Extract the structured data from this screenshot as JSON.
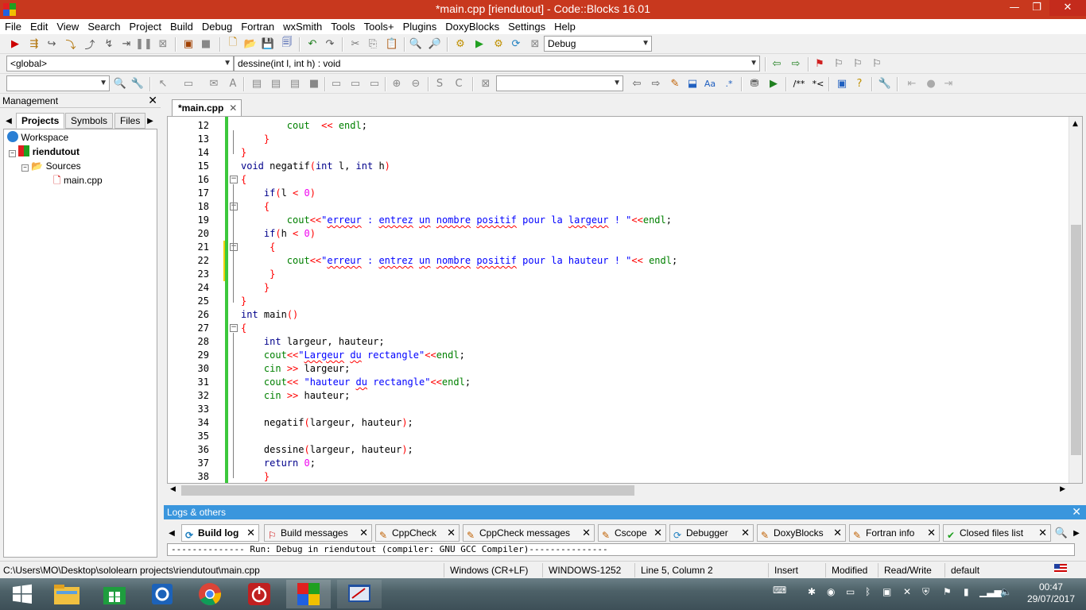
{
  "window": {
    "title": "*main.cpp [riendutout] - Code::Blocks 16.01",
    "minimize": "—",
    "restore": "❐",
    "close": "✕"
  },
  "menu": [
    "File",
    "Edit",
    "View",
    "Search",
    "Project",
    "Build",
    "Debug",
    "Fortran",
    "wxSmith",
    "Tools",
    "Tools+",
    "Plugins",
    "DoxyBlocks",
    "Settings",
    "Help"
  ],
  "toolbar": {
    "build_target": "Debug",
    "scope": "<global>",
    "function": "dessine(int l, int h) : void",
    "search_value": ""
  },
  "management": {
    "title": "Management",
    "tabs": [
      "Projects",
      "Symbols",
      "Files"
    ],
    "tree": {
      "workspace": "Workspace",
      "project": "riendutout",
      "folder": "Sources",
      "file": "main.cpp"
    }
  },
  "editor": {
    "tab_label": "*main.cpp",
    "lines": [
      {
        "n": "12",
        "indent": "        ",
        "tokens": [
          [
            "fn",
            "cout"
          ],
          [
            "",
            "  "
          ],
          [
            "op",
            "<<"
          ],
          [
            "",
            ""
          ],
          [
            "fn",
            " endl"
          ],
          [
            "",
            "; "
          ]
        ]
      },
      {
        "n": "13",
        "indent": "    ",
        "tokens": [
          [
            "brc",
            "}"
          ]
        ]
      },
      {
        "n": "14",
        "indent": "",
        "tokens": [
          [
            "brc",
            "}"
          ]
        ]
      },
      {
        "n": "15",
        "indent": "",
        "tokens": [
          [
            "kw",
            "void"
          ],
          [
            "",
            " negatif"
          ],
          [
            "op",
            "("
          ],
          [
            "kw",
            "int"
          ],
          [
            "",
            " l, "
          ],
          [
            "kw",
            "int"
          ],
          [
            "",
            " h"
          ],
          [
            "op",
            ")"
          ]
        ]
      },
      {
        "n": "16",
        "indent": "",
        "tokens": [
          [
            "brc",
            "{"
          ]
        ]
      },
      {
        "n": "17",
        "indent": "    ",
        "tokens": [
          [
            "kw",
            "if"
          ],
          [
            "op",
            "("
          ],
          [
            "",
            "l "
          ],
          [
            "op",
            "<"
          ],
          [
            "num",
            " 0"
          ],
          [
            "op",
            ")"
          ]
        ]
      },
      {
        "n": "18",
        "indent": "    ",
        "tokens": [
          [
            "brc",
            "{"
          ]
        ]
      },
      {
        "n": "19",
        "indent": "        ",
        "tokens": [
          [
            "fn",
            "cout"
          ],
          [
            "op",
            "<<"
          ],
          [
            "str",
            "\""
          ],
          [
            "sq",
            "erreur"
          ],
          [
            "str",
            " : "
          ],
          [
            "sq",
            "entrez"
          ],
          [
            "str",
            " "
          ],
          [
            "sq",
            "un"
          ],
          [
            "str",
            " "
          ],
          [
            "sq",
            "nombre"
          ],
          [
            "str",
            " "
          ],
          [
            "sq",
            "positif"
          ],
          [
            "str",
            " pour la "
          ],
          [
            "sq",
            "largeur"
          ],
          [
            "str",
            " ! \""
          ],
          [
            "op",
            "<<"
          ],
          [
            "fn",
            "endl"
          ],
          [
            "",
            ";"
          ]
        ]
      },
      {
        "n": "20",
        "indent": "    ",
        "tokens": [
          [
            "kw",
            "if"
          ],
          [
            "op",
            "("
          ],
          [
            "",
            "h "
          ],
          [
            "op",
            "<"
          ],
          [
            "num",
            " 0"
          ],
          [
            "op",
            ")"
          ]
        ]
      },
      {
        "n": "21",
        "indent": "     ",
        "tokens": [
          [
            "brc",
            "{"
          ]
        ]
      },
      {
        "n": "22",
        "indent": "        ",
        "tokens": [
          [
            "fn",
            "cout"
          ],
          [
            "op",
            "<<"
          ],
          [
            "str",
            "\""
          ],
          [
            "sq",
            "erreur"
          ],
          [
            "str",
            " : "
          ],
          [
            "sq",
            "entrez"
          ],
          [
            "str",
            " "
          ],
          [
            "sq",
            "un"
          ],
          [
            "str",
            " "
          ],
          [
            "sq",
            "nombre"
          ],
          [
            "str",
            " "
          ],
          [
            "sq",
            "positif"
          ],
          [
            "str",
            " pour la hauteur ! \""
          ],
          [
            "op",
            "<<"
          ],
          [
            "fn",
            " endl"
          ],
          [
            "",
            ";"
          ]
        ]
      },
      {
        "n": "23",
        "indent": "     ",
        "tokens": [
          [
            "brc",
            "}"
          ]
        ]
      },
      {
        "n": "24",
        "indent": "    ",
        "tokens": [
          [
            "brc",
            "}"
          ]
        ]
      },
      {
        "n": "25",
        "indent": "",
        "tokens": [
          [
            "brc",
            "}"
          ]
        ]
      },
      {
        "n": "26",
        "indent": "",
        "tokens": [
          [
            "kw",
            "int"
          ],
          [
            "",
            " main"
          ],
          [
            "op",
            "()"
          ]
        ]
      },
      {
        "n": "27",
        "indent": "",
        "tokens": [
          [
            "brc",
            "{"
          ]
        ]
      },
      {
        "n": "28",
        "indent": "    ",
        "tokens": [
          [
            "kw",
            "int"
          ],
          [
            "",
            " largeur, hauteur;"
          ]
        ]
      },
      {
        "n": "29",
        "indent": "    ",
        "tokens": [
          [
            "fn",
            "cout"
          ],
          [
            "op",
            "<<"
          ],
          [
            "str",
            "\""
          ],
          [
            "sq",
            "Largeur"
          ],
          [
            "str",
            " "
          ],
          [
            "sq",
            "du"
          ],
          [
            "str",
            " rectangle\""
          ],
          [
            "op",
            "<<"
          ],
          [
            "fn",
            "endl"
          ],
          [
            "",
            ";"
          ]
        ]
      },
      {
        "n": "30",
        "indent": "    ",
        "tokens": [
          [
            "fn",
            "cin"
          ],
          [
            "op",
            " >>"
          ],
          [
            "",
            " largeur;"
          ]
        ]
      },
      {
        "n": "31",
        "indent": "    ",
        "tokens": [
          [
            "fn",
            "cout"
          ],
          [
            "op",
            "<<"
          ],
          [
            "str",
            " \"hauteur "
          ],
          [
            "sq",
            "du"
          ],
          [
            "str",
            " rectangle\""
          ],
          [
            "op",
            "<<"
          ],
          [
            "fn",
            "endl"
          ],
          [
            "",
            ";"
          ]
        ]
      },
      {
        "n": "32",
        "indent": "    ",
        "tokens": [
          [
            "fn",
            "cin"
          ],
          [
            "op",
            " >>"
          ],
          [
            "",
            " hauteur;"
          ]
        ]
      },
      {
        "n": "33",
        "indent": "",
        "tokens": []
      },
      {
        "n": "34",
        "indent": "    ",
        "tokens": [
          [
            "",
            "negatif"
          ],
          [
            "op",
            "("
          ],
          [
            "",
            "largeur, hauteur"
          ],
          [
            "op",
            ")"
          ],
          [
            "",
            ";"
          ]
        ]
      },
      {
        "n": "35",
        "indent": "",
        "tokens": []
      },
      {
        "n": "36",
        "indent": "    ",
        "tokens": [
          [
            "",
            "dessine"
          ],
          [
            "op",
            "("
          ],
          [
            "",
            "largeur, hauteur"
          ],
          [
            "op",
            ")"
          ],
          [
            "",
            ";"
          ]
        ]
      },
      {
        "n": "37",
        "indent": "    ",
        "tokens": [
          [
            "kw",
            "return"
          ],
          [
            "num",
            " 0"
          ],
          [
            "",
            ";"
          ]
        ]
      },
      {
        "n": "38",
        "indent": "    ",
        "tokens": [
          [
            "brc",
            "}"
          ]
        ]
      }
    ]
  },
  "logs": {
    "title": "Logs & others",
    "tabs": [
      "Build log",
      "Build messages",
      "CppCheck",
      "CppCheck messages",
      "Cscope",
      "Debugger",
      "DoxyBlocks",
      "Fortran info",
      "Closed files list"
    ],
    "content": "-------------- Run: Debug in riendutout (compiler: GNU GCC Compiler)---------------"
  },
  "status": {
    "path": "C:\\Users\\MO\\Desktop\\sololearn projects\\riendutout\\main.cpp",
    "eol": "Windows (CR+LF)",
    "encoding": "WINDOWS-1252",
    "position": "Line 5, Column 2",
    "mode": "Insert",
    "modified": "Modified",
    "access": "Read/Write",
    "profile": "default"
  },
  "taskbar": {
    "time": "00:47",
    "date": "29/07/2017"
  },
  "colors": {
    "titlebar": "#c8381e",
    "logs_header": "#3a96dd",
    "change_bar": "#3cc83c"
  }
}
